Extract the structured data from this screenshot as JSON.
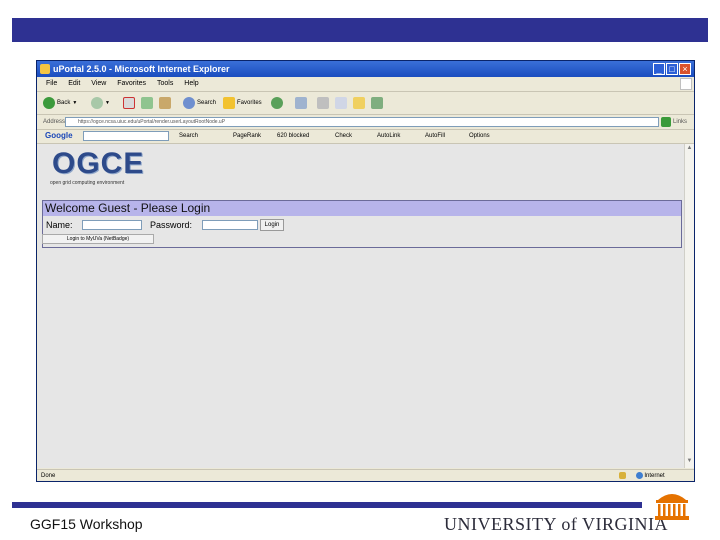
{
  "colors": {
    "brand_blue": "#2e3192",
    "login_header_bg": "#b7b4ea",
    "uva_orange": "#e57200"
  },
  "browser": {
    "title": "uPortal 2.5.0 - Microsoft Internet Explorer",
    "menu": [
      "File",
      "Edit",
      "View",
      "Favorites",
      "Tools",
      "Help"
    ],
    "toolbar": {
      "back": "Back",
      "search": "Search",
      "favorites": "Favorites"
    },
    "address": {
      "label": "Address",
      "url": "https://ogce.ncsa.uiuc.edu/uPortal/render.userLayoutRootNode.uP",
      "links": "Links"
    },
    "google": {
      "logo": "Google",
      "search": "Search",
      "pagerank": "PageRank",
      "blocked": "620 blocked",
      "check": "Check",
      "autolink": "AutoLink",
      "autofill": "AutoFill",
      "options": "Options"
    },
    "status": {
      "text": "Done",
      "zone": "Internet"
    }
  },
  "portal": {
    "logo": "OGCE",
    "tagline": "open grid computing environment",
    "login_header": "Welcome Guest - Please Login",
    "name_label": "Name:",
    "password_label": "Password:",
    "login_button": "Login",
    "alt_login": "Login to MyUVa (NetBadge)"
  },
  "footer": {
    "left": "GGF15 Workshop",
    "university": "UNIVERSITY of VIRGINIA"
  },
  "icons": [
    "ie-icon",
    "back-icon",
    "forward-icon",
    "stop-icon",
    "refresh-icon",
    "home-icon",
    "search-icon",
    "favorites-icon",
    "media-icon",
    "mail-icon",
    "print-icon",
    "edit-icon",
    "folder-icon",
    "messenger-icon",
    "go-icon",
    "lock-icon",
    "internet-zone-icon",
    "rotunda-logo"
  ]
}
